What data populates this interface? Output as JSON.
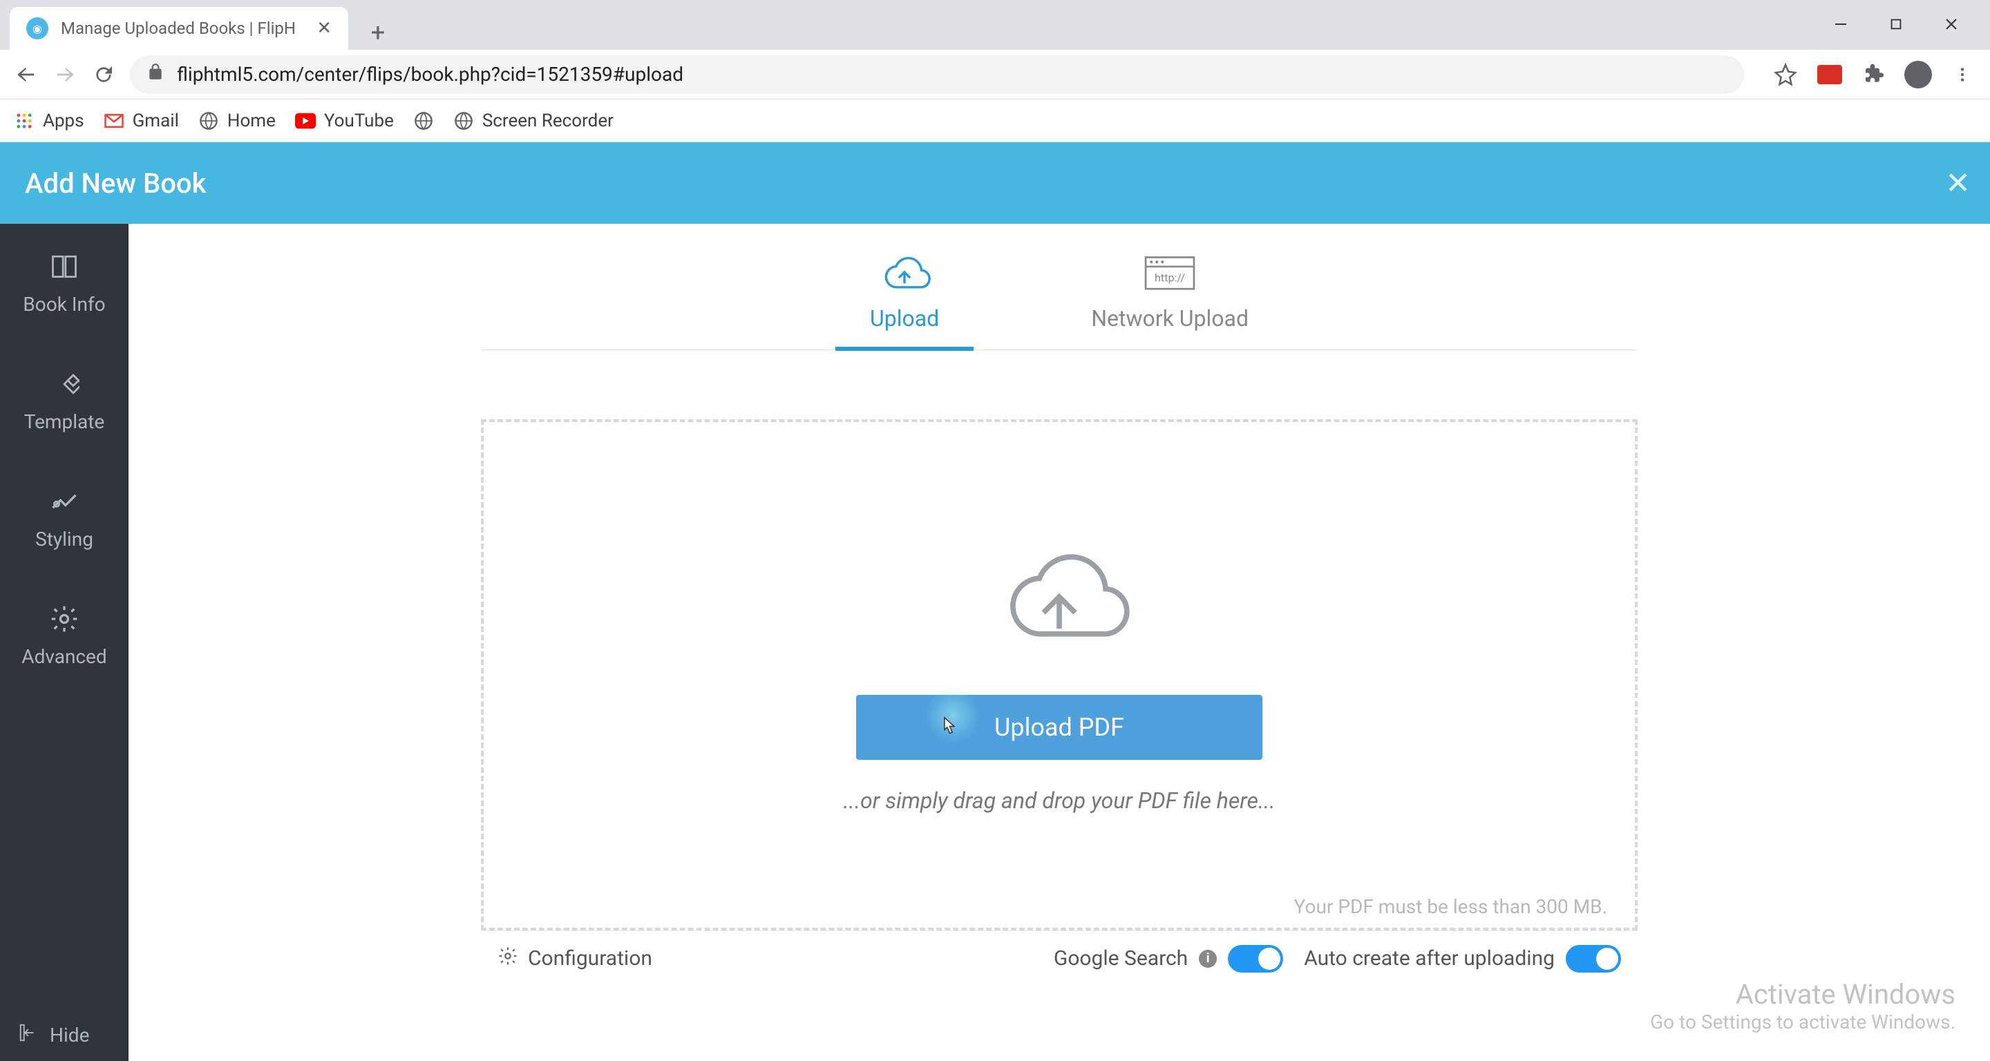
{
  "browser": {
    "tab_title": "Manage Uploaded Books | FlipH",
    "url": "fliphtml5.com/center/flips/book.php?cid=1521359#upload",
    "bookmarks": [
      "Apps",
      "Gmail",
      "Home",
      "YouTube",
      "Screen Recorder"
    ]
  },
  "header": {
    "title": "Add New Book"
  },
  "sidebar": {
    "items": [
      {
        "label": "Book Info"
      },
      {
        "label": "Template"
      },
      {
        "label": "Styling"
      },
      {
        "label": "Advanced"
      }
    ],
    "hide_label": "Hide"
  },
  "tabs": {
    "upload": "Upload",
    "network": "Network Upload",
    "http_label": "http://"
  },
  "dropzone": {
    "button": "Upload PDF",
    "hint": "...or simply drag and drop your PDF file here...",
    "size_note": "Your PDF must be less than 300 MB."
  },
  "footer": {
    "config": "Configuration",
    "google": "Google Search",
    "auto": "Auto create after uploading"
  },
  "watermark": {
    "line1": "Activate Windows",
    "line2": "Go to Settings to activate Windows."
  }
}
